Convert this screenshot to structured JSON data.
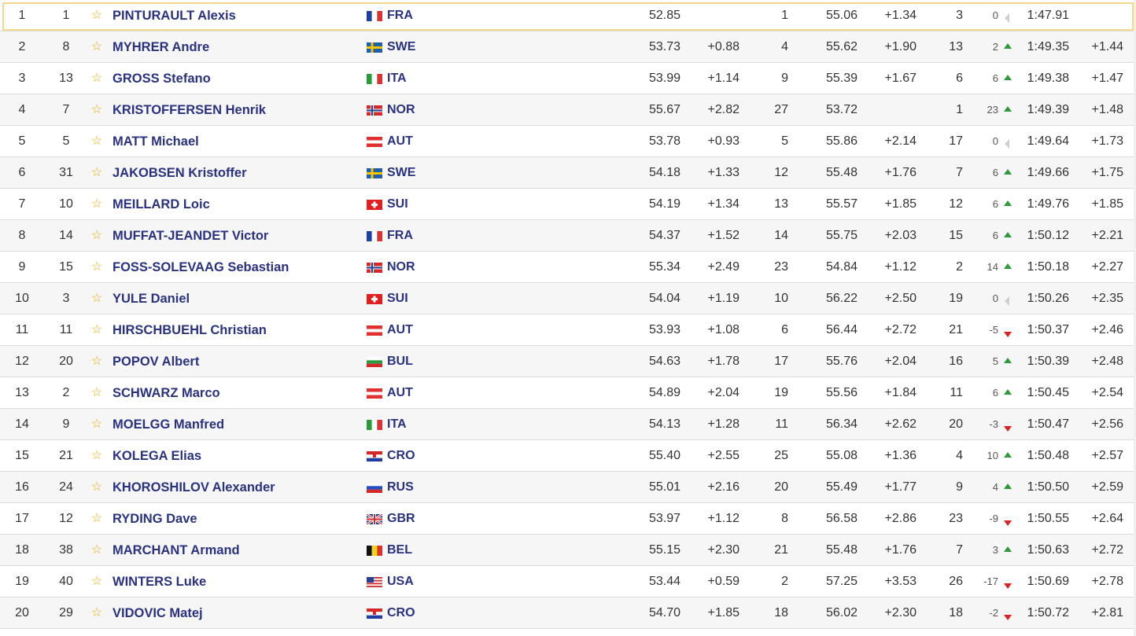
{
  "rows": [
    {
      "rank": "1",
      "bib": "1",
      "name": "PINTURAULT Alexis",
      "nation": "FRA",
      "flag": "fra",
      "run1": "52.85",
      "diff1": "",
      "rank1": "1",
      "run2": "55.06",
      "diff2": "+1.34",
      "rank2": "3",
      "move": "0",
      "dir": "same",
      "total": "1:47.91",
      "diff": ""
    },
    {
      "rank": "2",
      "bib": "8",
      "name": "MYHRER Andre",
      "nation": "SWE",
      "flag": "swe",
      "run1": "53.73",
      "diff1": "+0.88",
      "rank1": "4",
      "run2": "55.62",
      "diff2": "+1.90",
      "rank2": "13",
      "move": "2",
      "dir": "up",
      "total": "1:49.35",
      "diff": "+1.44"
    },
    {
      "rank": "3",
      "bib": "13",
      "name": "GROSS Stefano",
      "nation": "ITA",
      "flag": "ita",
      "run1": "53.99",
      "diff1": "+1.14",
      "rank1": "9",
      "run2": "55.39",
      "diff2": "+1.67",
      "rank2": "6",
      "move": "6",
      "dir": "up",
      "total": "1:49.38",
      "diff": "+1.47"
    },
    {
      "rank": "4",
      "bib": "7",
      "name": "KRISTOFFERSEN Henrik",
      "nation": "NOR",
      "flag": "nor",
      "run1": "55.67",
      "diff1": "+2.82",
      "rank1": "27",
      "run2": "53.72",
      "diff2": "",
      "rank2": "1",
      "move": "23",
      "dir": "up",
      "total": "1:49.39",
      "diff": "+1.48"
    },
    {
      "rank": "5",
      "bib": "5",
      "name": "MATT Michael",
      "nation": "AUT",
      "flag": "aut",
      "run1": "53.78",
      "diff1": "+0.93",
      "rank1": "5",
      "run2": "55.86",
      "diff2": "+2.14",
      "rank2": "17",
      "move": "0",
      "dir": "same",
      "total": "1:49.64",
      "diff": "+1.73"
    },
    {
      "rank": "6",
      "bib": "31",
      "name": "JAKOBSEN Kristoffer",
      "nation": "SWE",
      "flag": "swe",
      "run1": "54.18",
      "diff1": "+1.33",
      "rank1": "12",
      "run2": "55.48",
      "diff2": "+1.76",
      "rank2": "7",
      "move": "6",
      "dir": "up",
      "total": "1:49.66",
      "diff": "+1.75"
    },
    {
      "rank": "7",
      "bib": "10",
      "name": "MEILLARD Loic",
      "nation": "SUI",
      "flag": "sui",
      "run1": "54.19",
      "diff1": "+1.34",
      "rank1": "13",
      "run2": "55.57",
      "diff2": "+1.85",
      "rank2": "12",
      "move": "6",
      "dir": "up",
      "total": "1:49.76",
      "diff": "+1.85"
    },
    {
      "rank": "8",
      "bib": "14",
      "name": "MUFFAT-JEANDET Victor",
      "nation": "FRA",
      "flag": "fra",
      "run1": "54.37",
      "diff1": "+1.52",
      "rank1": "14",
      "run2": "55.75",
      "diff2": "+2.03",
      "rank2": "15",
      "move": "6",
      "dir": "up",
      "total": "1:50.12",
      "diff": "+2.21"
    },
    {
      "rank": "9",
      "bib": "15",
      "name": "FOSS-SOLEVAAG Sebastian",
      "nation": "NOR",
      "flag": "nor",
      "run1": "55.34",
      "diff1": "+2.49",
      "rank1": "23",
      "run2": "54.84",
      "diff2": "+1.12",
      "rank2": "2",
      "move": "14",
      "dir": "up",
      "total": "1:50.18",
      "diff": "+2.27"
    },
    {
      "rank": "10",
      "bib": "3",
      "name": "YULE Daniel",
      "nation": "SUI",
      "flag": "sui",
      "run1": "54.04",
      "diff1": "+1.19",
      "rank1": "10",
      "run2": "56.22",
      "diff2": "+2.50",
      "rank2": "19",
      "move": "0",
      "dir": "same",
      "total": "1:50.26",
      "diff": "+2.35"
    },
    {
      "rank": "11",
      "bib": "11",
      "name": "HIRSCHBUEHL Christian",
      "nation": "AUT",
      "flag": "aut",
      "run1": "53.93",
      "diff1": "+1.08",
      "rank1": "6",
      "run2": "56.44",
      "diff2": "+2.72",
      "rank2": "21",
      "move": "-5",
      "dir": "down",
      "total": "1:50.37",
      "diff": "+2.46"
    },
    {
      "rank": "12",
      "bib": "20",
      "name": "POPOV Albert",
      "nation": "BUL",
      "flag": "bul",
      "run1": "54.63",
      "diff1": "+1.78",
      "rank1": "17",
      "run2": "55.76",
      "diff2": "+2.04",
      "rank2": "16",
      "move": "5",
      "dir": "up",
      "total": "1:50.39",
      "diff": "+2.48"
    },
    {
      "rank": "13",
      "bib": "2",
      "name": "SCHWARZ Marco",
      "nation": "AUT",
      "flag": "aut",
      "run1": "54.89",
      "diff1": "+2.04",
      "rank1": "19",
      "run2": "55.56",
      "diff2": "+1.84",
      "rank2": "11",
      "move": "6",
      "dir": "up",
      "total": "1:50.45",
      "diff": "+2.54"
    },
    {
      "rank": "14",
      "bib": "9",
      "name": "MOELGG Manfred",
      "nation": "ITA",
      "flag": "ita",
      "run1": "54.13",
      "diff1": "+1.28",
      "rank1": "11",
      "run2": "56.34",
      "diff2": "+2.62",
      "rank2": "20",
      "move": "-3",
      "dir": "down",
      "total": "1:50.47",
      "diff": "+2.56"
    },
    {
      "rank": "15",
      "bib": "21",
      "name": "KOLEGA Elias",
      "nation": "CRO",
      "flag": "cro",
      "run1": "55.40",
      "diff1": "+2.55",
      "rank1": "25",
      "run2": "55.08",
      "diff2": "+1.36",
      "rank2": "4",
      "move": "10",
      "dir": "up",
      "total": "1:50.48",
      "diff": "+2.57"
    },
    {
      "rank": "16",
      "bib": "24",
      "name": "KHOROSHILOV Alexander",
      "nation": "RUS",
      "flag": "rus",
      "run1": "55.01",
      "diff1": "+2.16",
      "rank1": "20",
      "run2": "55.49",
      "diff2": "+1.77",
      "rank2": "9",
      "move": "4",
      "dir": "up",
      "total": "1:50.50",
      "diff": "+2.59"
    },
    {
      "rank": "17",
      "bib": "12",
      "name": "RYDING Dave",
      "nation": "GBR",
      "flag": "gbr",
      "run1": "53.97",
      "diff1": "+1.12",
      "rank1": "8",
      "run2": "56.58",
      "diff2": "+2.86",
      "rank2": "23",
      "move": "-9",
      "dir": "down",
      "total": "1:50.55",
      "diff": "+2.64"
    },
    {
      "rank": "18",
      "bib": "38",
      "name": "MARCHANT Armand",
      "nation": "BEL",
      "flag": "bel",
      "run1": "55.15",
      "diff1": "+2.30",
      "rank1": "21",
      "run2": "55.48",
      "diff2": "+1.76",
      "rank2": "7",
      "move": "3",
      "dir": "up",
      "total": "1:50.63",
      "diff": "+2.72"
    },
    {
      "rank": "19",
      "bib": "40",
      "name": "WINTERS Luke",
      "nation": "USA",
      "flag": "usa",
      "run1": "53.44",
      "diff1": "+0.59",
      "rank1": "2",
      "run2": "57.25",
      "diff2": "+3.53",
      "rank2": "26",
      "move": "-17",
      "dir": "down",
      "total": "1:50.69",
      "diff": "+2.78"
    },
    {
      "rank": "20",
      "bib": "29",
      "name": "VIDOVIC Matej",
      "nation": "CRO",
      "flag": "cro",
      "run1": "54.70",
      "diff1": "+1.85",
      "rank1": "18",
      "run2": "56.02",
      "diff2": "+2.30",
      "rank2": "18",
      "move": "-2",
      "dir": "down",
      "total": "1:50.72",
      "diff": "+2.81"
    }
  ],
  "icons": {
    "favorite": "star-outline-icon",
    "up": "triangle-up-icon",
    "down": "triangle-down-icon",
    "same": "triangle-left-icon"
  },
  "colors": {
    "name": "#2a3280",
    "star": "#e8a812",
    "up": "#2e9b3a",
    "down": "#e02020",
    "same": "#cfcfcf",
    "highlight_border": "#f5d98a"
  }
}
